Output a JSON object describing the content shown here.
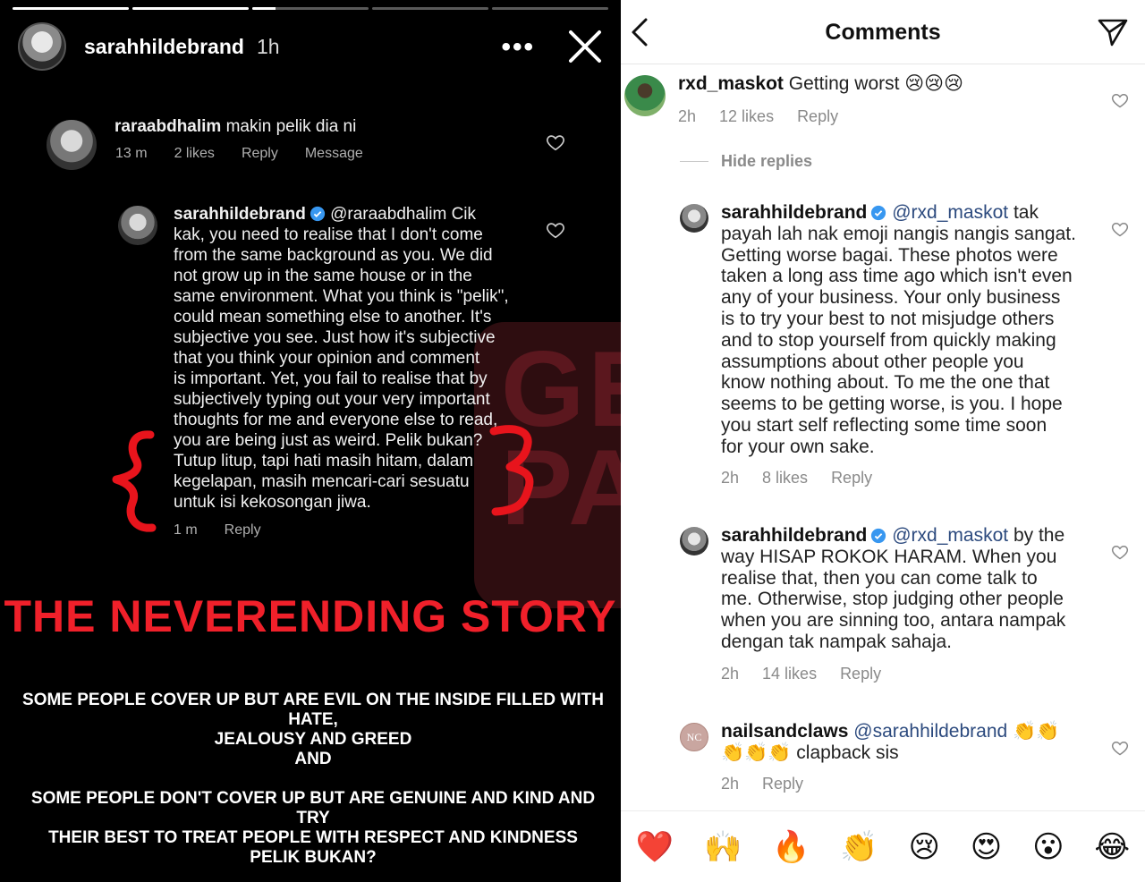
{
  "story": {
    "username": "sarahhildebrand",
    "time": "1h",
    "progress": [
      1,
      1,
      0.2,
      0,
      0
    ],
    "menu_label": "•••",
    "screenshot_comment_1": {
      "username": "raraabdhalim",
      "text": "makin pelik dia ni",
      "time": "13 m",
      "likes": "2 likes",
      "reply": "Reply",
      "message": "Message"
    },
    "screenshot_comment_2": {
      "username": "sarahhildebrand",
      "mention": "@raraabdhalim",
      "lines": [
        "Cik",
        "kak, you need to realise that I don't come",
        "from the same background as you. We did",
        "not grow up in the same house or in the",
        "same environment. What you think is \"pelik\",",
        "could mean something else to another. It's",
        "subjective you see. Just how it's subjective",
        "that you think your opinion and comment",
        "is important. Yet, you fail to realise that by",
        "subjectively typing out your very important",
        "thoughts for me and everyone else to read,",
        "you are being just as weird. Pelik bukan?",
        "Tutup litup, tapi hati masih hitam, dalam",
        "kegelapan, masih mencari-cari sesuatu",
        "untuk isi kekosongan jiwa."
      ],
      "time": "1 m",
      "reply": "Reply"
    },
    "headline": "THE NEVERENDING STORY",
    "body": {
      "p1a": "SOME PEOPLE COVER UP BUT ARE EVIL ON THE INSIDE FILLED WITH HATE,",
      "p1b": "JEALOUSY AND GREED",
      "and": "AND",
      "p2a": "SOME PEOPLE DON'T COVER UP BUT ARE GENUINE AND KIND AND TRY",
      "p2b": "THEIR BEST TO TREAT PEOPLE WITH RESPECT AND  KINDNESS",
      "p3": "PELIK BUKAN?"
    },
    "watermark": "GEMPAK"
  },
  "comments_panel": {
    "title": "Comments",
    "hide_replies": "Hide replies",
    "comments": [
      {
        "username": "rxd_maskot",
        "text": "Getting worst 😢😢😢",
        "time": "2h",
        "likes": "12 likes",
        "reply": "Reply"
      },
      {
        "username": "sarahhildebrand",
        "mention": "@rxd_maskot",
        "lines": [
          "tak",
          "payah lah nak emoji nangis nangis sangat.",
          "Getting worse bagai. These photos were",
          "taken a long ass time ago which isn't even",
          "any of your business. Your only business",
          "is to try your best to not misjudge others",
          "and to stop yourself from quickly making",
          "assumptions about other people you",
          "know nothing about. To me the one that",
          "seems to be getting worse, is you. I hope",
          "you start self reflecting some time soon",
          "for your own sake."
        ],
        "time": "2h",
        "likes": "8 likes",
        "reply": "Reply"
      },
      {
        "username": "sarahhildebrand",
        "mention": "@rxd_maskot",
        "lines": [
          "by the",
          "way HISAP ROKOK HARAM. When you",
          "realise that, then you can come talk to",
          "me. Otherwise, stop judging other people",
          "when you are sinning too, antara nampak",
          "dengan tak nampak sahaja."
        ],
        "time": "2h",
        "likes": "14 likes",
        "reply": "Reply"
      },
      {
        "username": "nailsandclaws",
        "avatar_text": "NC",
        "mention": "@sarahhildebrand",
        "line1_suffix": "👏👏",
        "line2": "👏👏👏 clapback sis",
        "time": "2h",
        "reply": "Reply"
      }
    ],
    "emoji_bar": [
      "❤️",
      "🙌",
      "🔥",
      "👏",
      "😢",
      "😍",
      "😮",
      "😂"
    ]
  }
}
